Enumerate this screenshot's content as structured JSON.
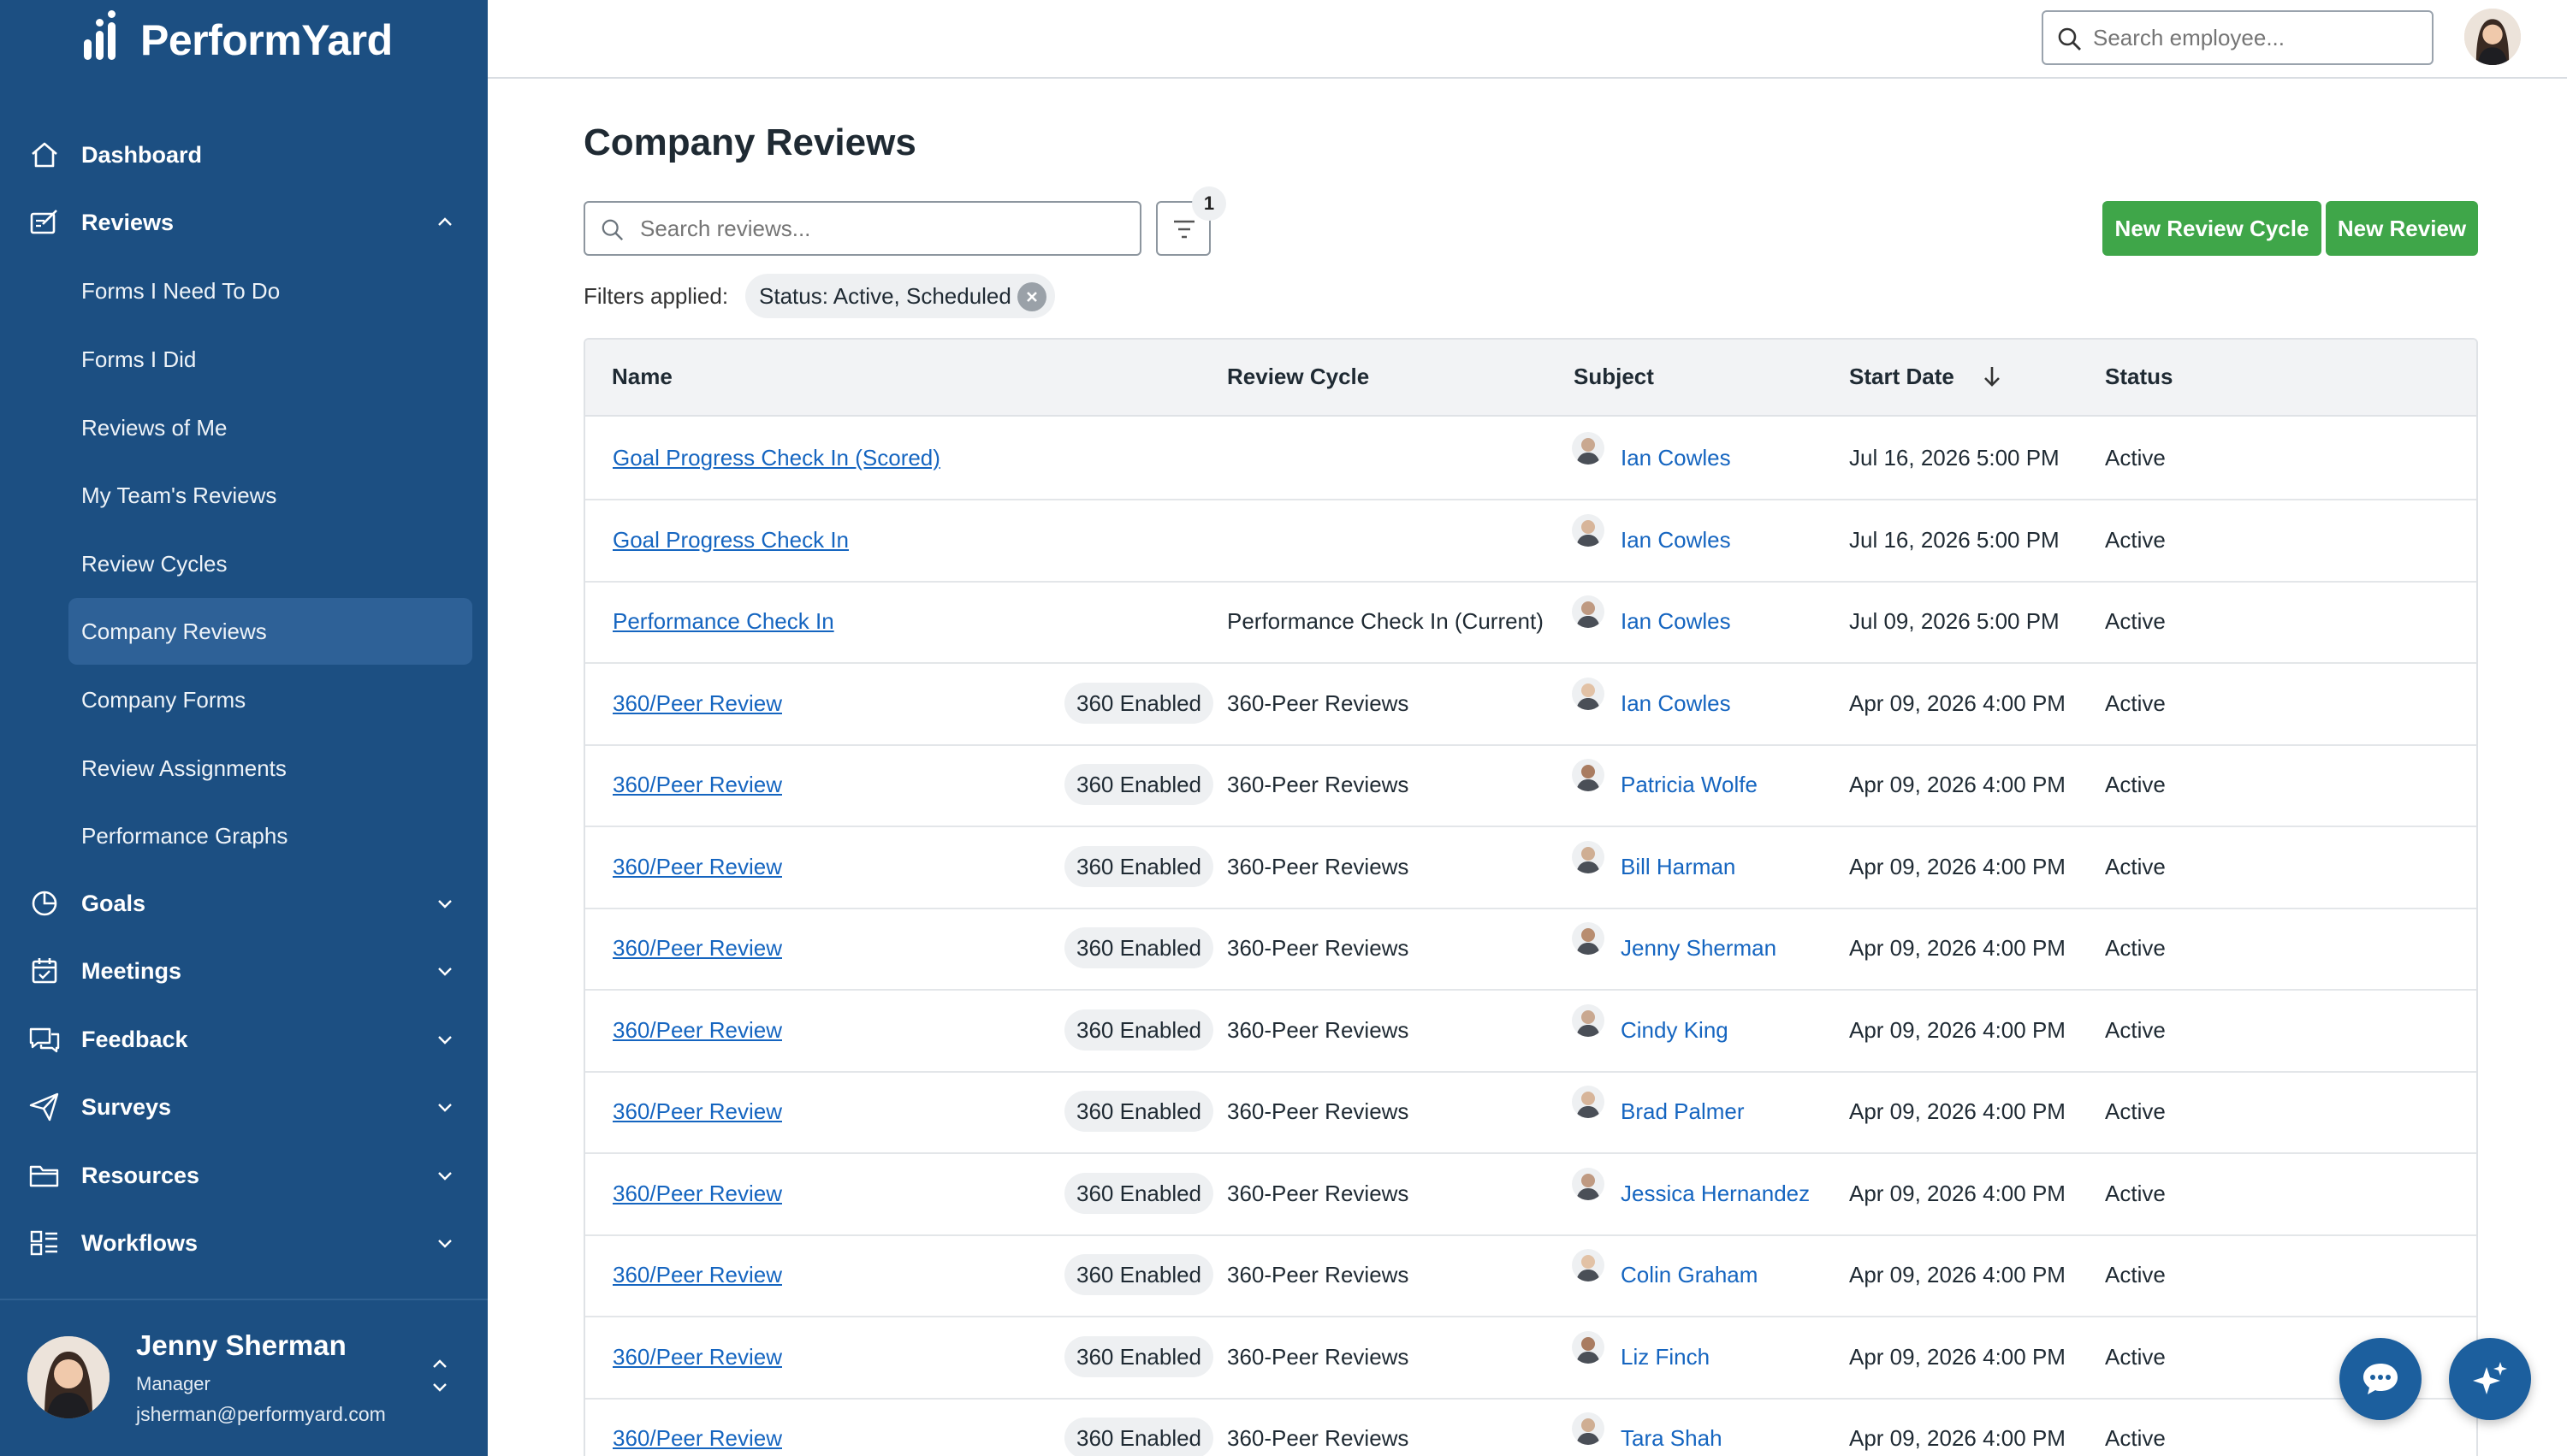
{
  "app": {
    "logo_text": "PerformYard"
  },
  "sidebar": {
    "nav": [
      {
        "label": "Dashboard",
        "icon": "home-icon"
      },
      {
        "label": "Reviews",
        "icon": "reviews-icon",
        "expanded": true
      },
      {
        "label": "Goals",
        "icon": "goals-icon"
      },
      {
        "label": "Meetings",
        "icon": "calendar-icon"
      },
      {
        "label": "Feedback",
        "icon": "chat-icon"
      },
      {
        "label": "Surveys",
        "icon": "send-icon"
      },
      {
        "label": "Resources",
        "icon": "folder-icon"
      },
      {
        "label": "Workflows",
        "icon": "grid-icon"
      }
    ],
    "reviews_sub": [
      "Forms I Need To Do",
      "Forms I Did",
      "Reviews of Me",
      "My Team's Reviews",
      "Review Cycles",
      "Company Reviews",
      "Company Forms",
      "Review Assignments",
      "Performance Graphs"
    ],
    "active_sub": "Company Reviews",
    "user": {
      "name": "Jenny Sherman",
      "role": "Manager",
      "email": "jsherman@performyard.com"
    }
  },
  "topbar": {
    "search_placeholder": "Search employee..."
  },
  "main": {
    "title": "Company Reviews",
    "search_placeholder": "Search reviews...",
    "filter_count": "1",
    "new_cycle_label": "New Review Cycle",
    "new_review_label": "New Review",
    "filters_label": "Filters applied:",
    "filter_chip": "Status: Active, Scheduled"
  },
  "table": {
    "headers": {
      "name": "Name",
      "cycle": "Review Cycle",
      "subject": "Subject",
      "start": "Start Date",
      "status": "Status"
    },
    "rows": [
      {
        "name": "Goal Progress Check In (Scored)",
        "badge": "",
        "cycle": "",
        "subject": "Ian Cowles",
        "start": "Jul 16, 2026 5:00 PM",
        "status": "Active"
      },
      {
        "name": "Goal Progress Check In",
        "badge": "",
        "cycle": "",
        "subject": "Ian Cowles",
        "start": "Jul 16, 2026 5:00 PM",
        "status": "Active"
      },
      {
        "name": "Performance Check In",
        "badge": "",
        "cycle": "Performance Check In (Current)",
        "subject": "Ian Cowles",
        "start": "Jul 09, 2026 5:00 PM",
        "status": "Active"
      },
      {
        "name": "360/Peer Review",
        "badge": "360 Enabled",
        "cycle": "360-Peer Reviews",
        "subject": "Ian Cowles",
        "start": "Apr 09, 2026 4:00 PM",
        "status": "Active"
      },
      {
        "name": "360/Peer Review",
        "badge": "360 Enabled",
        "cycle": "360-Peer Reviews",
        "subject": "Patricia Wolfe",
        "start": "Apr 09, 2026 4:00 PM",
        "status": "Active"
      },
      {
        "name": "360/Peer Review",
        "badge": "360 Enabled",
        "cycle": "360-Peer Reviews",
        "subject": "Bill Harman",
        "start": "Apr 09, 2026 4:00 PM",
        "status": "Active"
      },
      {
        "name": "360/Peer Review",
        "badge": "360 Enabled",
        "cycle": "360-Peer Reviews",
        "subject": "Jenny Sherman",
        "start": "Apr 09, 2026 4:00 PM",
        "status": "Active"
      },
      {
        "name": "360/Peer Review",
        "badge": "360 Enabled",
        "cycle": "360-Peer Reviews",
        "subject": "Cindy King",
        "start": "Apr 09, 2026 4:00 PM",
        "status": "Active"
      },
      {
        "name": "360/Peer Review",
        "badge": "360 Enabled",
        "cycle": "360-Peer Reviews",
        "subject": "Brad Palmer",
        "start": "Apr 09, 2026 4:00 PM",
        "status": "Active"
      },
      {
        "name": "360/Peer Review",
        "badge": "360 Enabled",
        "cycle": "360-Peer Reviews",
        "subject": "Jessica Hernandez",
        "start": "Apr 09, 2026 4:00 PM",
        "status": "Active"
      },
      {
        "name": "360/Peer Review",
        "badge": "360 Enabled",
        "cycle": "360-Peer Reviews",
        "subject": "Colin Graham",
        "start": "Apr 09, 2026 4:00 PM",
        "status": "Active"
      },
      {
        "name": "360/Peer Review",
        "badge": "360 Enabled",
        "cycle": "360-Peer Reviews",
        "subject": "Liz Finch",
        "start": "Apr 09, 2026 4:00 PM",
        "status": "Active"
      },
      {
        "name": "360/Peer Review",
        "badge": "360 Enabled",
        "cycle": "360-Peer Reviews",
        "subject": "Tara Shah",
        "start": "Apr 09, 2026 4:00 PM",
        "status": "Active"
      }
    ]
  },
  "colors": {
    "sidebar": "#1c4f82",
    "active_sub": "#2e6197",
    "accent_green": "#3fa649",
    "link": "#1565c0",
    "fab": "#1c5f9e"
  }
}
